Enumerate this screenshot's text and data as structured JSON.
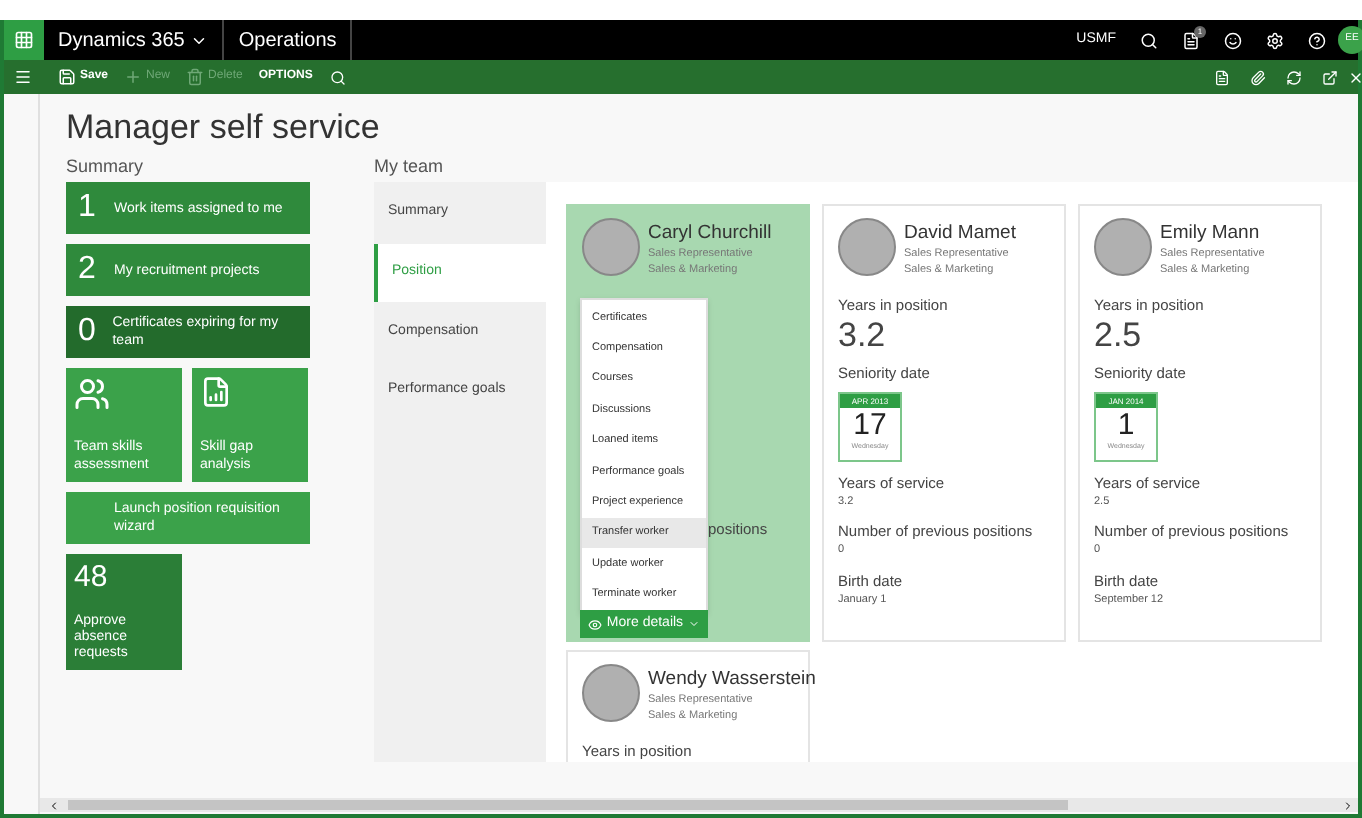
{
  "top_bar": {
    "product": "Dynamics 365",
    "module": "Operations",
    "company": "USMF",
    "notification_count": "1",
    "avatar_initials": "EE"
  },
  "toolbar": {
    "items": [
      {
        "kind": "save",
        "label": "Save",
        "disabled": false
      },
      {
        "kind": "new",
        "label": "New",
        "disabled": true
      },
      {
        "kind": "delete",
        "label": "Delete",
        "disabled": true
      },
      {
        "kind": "options",
        "label": "OPTIONS",
        "disabled": false
      }
    ]
  },
  "page_title": "Manager self service",
  "summary": {
    "heading": "Summary",
    "tiles": [
      {
        "kind": "count",
        "count": "1",
        "label": "Work items assigned to me",
        "color": "#2f8a3c"
      },
      {
        "kind": "count",
        "count": "2",
        "label": "My recruitment projects",
        "color": "#2f8a3c"
      },
      {
        "kind": "count",
        "count": "0",
        "label": "Certificates expiring for my team",
        "color": "#236b2c"
      },
      {
        "kind": "people",
        "label": "Team skills assessment",
        "color": "#3ba24a"
      },
      {
        "kind": "report",
        "label": "Skill gap analysis",
        "color": "#3ba24a"
      },
      {
        "kind": "wide",
        "label": "Launch position requisition wizard",
        "color": "#3ba24a"
      },
      {
        "kind": "big",
        "count": "48",
        "label": "Approve absence requests",
        "color": "#2b7e37"
      }
    ]
  },
  "my_team": {
    "heading": "My team",
    "tabs": [
      {
        "label": "Summary",
        "selected": false
      },
      {
        "label": "Position",
        "selected": true
      },
      {
        "label": "Compensation",
        "selected": false
      },
      {
        "label": "Performance goals",
        "selected": false
      }
    ],
    "cards": [
      {
        "name": "Caryl Churchill",
        "title": "Sales Representative",
        "department": "Sales & Marketing",
        "selected": true,
        "visible_fragment": "positions",
        "menu": {
          "items": [
            {
              "label": "Certificates",
              "selected": false
            },
            {
              "label": "Compensation",
              "selected": false
            },
            {
              "label": "Courses",
              "selected": false
            },
            {
              "label": "Discussions",
              "selected": false
            },
            {
              "label": "Loaned items",
              "selected": false
            },
            {
              "label": "Performance goals",
              "selected": false
            },
            {
              "label": "Project experience",
              "selected": false
            },
            {
              "label": "Transfer worker",
              "selected": true
            },
            {
              "label": "Update worker",
              "selected": false
            },
            {
              "label": "Terminate worker",
              "selected": false
            }
          ]
        },
        "more_button": "More details"
      },
      {
        "name": "David Mamet",
        "title": "Sales Representative",
        "department": "Sales & Marketing",
        "selected": false,
        "fields": [
          {
            "label": "Years in position",
            "value": "3.2",
            "kind": "big"
          },
          {
            "label": "Seniority date",
            "kind": "calendar",
            "month": "APR 2013",
            "day": "17",
            "weekday": "Wednesday"
          },
          {
            "label": "Years of service",
            "value": "3.2",
            "kind": "small"
          },
          {
            "label": "Number of previous positions",
            "value": "0",
            "kind": "small"
          },
          {
            "label": "Birth date",
            "value": "January 1",
            "kind": "small"
          }
        ]
      },
      {
        "name": "Emily Mann",
        "title": "Sales Representative",
        "department": "Sales & Marketing",
        "selected": false,
        "fields": [
          {
            "label": "Years in position",
            "value": "2.5",
            "kind": "big"
          },
          {
            "label": "Seniority date",
            "kind": "calendar",
            "month": "JAN 2014",
            "day": "1",
            "weekday": "Wednesday"
          },
          {
            "label": "Years of service",
            "value": "2.5",
            "kind": "small"
          },
          {
            "label": "Number of previous positions",
            "value": "0",
            "kind": "small"
          },
          {
            "label": "Birth date",
            "value": "September 12",
            "kind": "small"
          }
        ]
      },
      {
        "name": "Wendy Wasserstein",
        "title": "Sales Representative",
        "department": "Sales & Marketing",
        "selected": false,
        "fields": [
          {
            "label": "Years in position",
            "kind": "label"
          }
        ]
      }
    ]
  }
}
